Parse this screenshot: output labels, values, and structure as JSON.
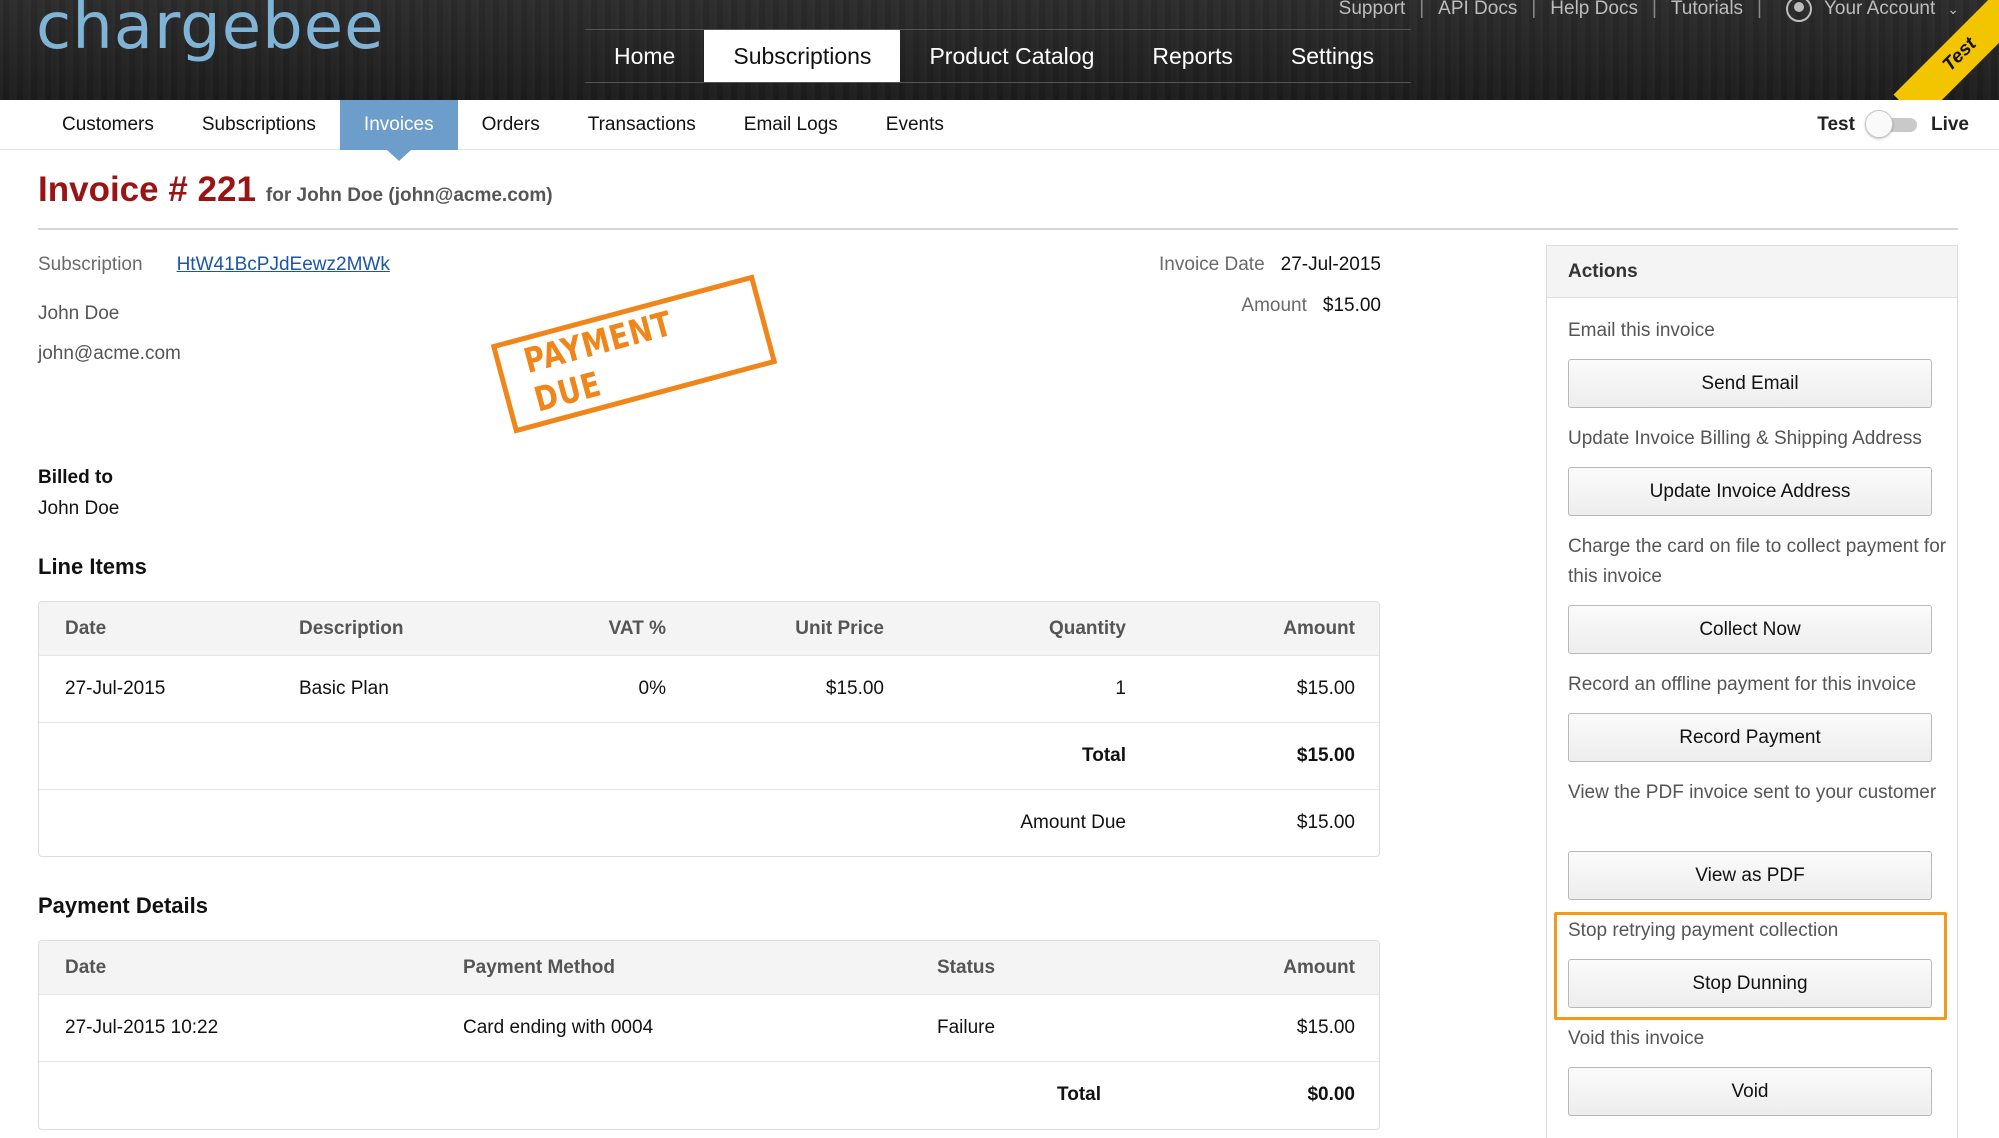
{
  "header": {
    "logo_text": "chargebee",
    "utility_links": [
      "Support",
      "API Docs",
      "Help Docs",
      "Tutorials"
    ],
    "account_label": "Your Account",
    "main_nav": [
      "Home",
      "Subscriptions",
      "Product Catalog",
      "Reports",
      "Settings"
    ],
    "main_nav_active": "Subscriptions",
    "ribbon_text": "Test",
    "ribbon_color": "#f2c500"
  },
  "subnav": {
    "items": [
      "Customers",
      "Subscriptions",
      "Invoices",
      "Orders",
      "Transactions",
      "Email Logs",
      "Events"
    ],
    "active": "Invoices",
    "active_color": "#6d9ecb",
    "mode_left": "Test",
    "mode_right": "Live"
  },
  "invoice": {
    "title": "Invoice # 221",
    "for_text": "for John Doe (john@acme.com)",
    "subscription_label": "Subscription",
    "subscription_id": "HtW41BcPJdEewz2MWk",
    "customer_name": "John Doe",
    "customer_email": "john@acme.com",
    "stamp_text": "PAYMENT DUE",
    "invoice_date_label": "Invoice Date",
    "invoice_date": "27-Jul-2015",
    "amount_label": "Amount",
    "amount": "$15.00",
    "billed_to_label": "Billed to",
    "billed_to_name": "John Doe"
  },
  "line_items": {
    "heading": "Line Items",
    "columns": [
      "Date",
      "Description",
      "VAT %",
      "Unit Price",
      "Quantity",
      "Amount"
    ],
    "rows": [
      [
        "27-Jul-2015",
        "Basic Plan",
        "0%",
        "$15.00",
        "1",
        "$15.00"
      ]
    ],
    "total_label": "Total",
    "total_value": "$15.00",
    "amount_due_label": "Amount Due",
    "amount_due_value": "$15.00"
  },
  "payment_details": {
    "heading": "Payment Details",
    "columns": [
      "Date",
      "Payment Method",
      "Status",
      "Amount"
    ],
    "rows": [
      [
        "27-Jul-2015 10:22",
        "Card ending with 0004",
        "Failure",
        "$15.00"
      ]
    ],
    "total_label": "Total",
    "total_value": "$0.00",
    "failure_color": "#cc3a0c"
  },
  "actions": {
    "heading": "Actions",
    "items": [
      {
        "desc": "Email this invoice",
        "button": "Send Email"
      },
      {
        "desc": "Update Invoice Billing & Shipping Address",
        "button": "Update Invoice Address"
      },
      {
        "desc": "Charge the card on file to collect payment for this invoice",
        "button": "Collect Now"
      },
      {
        "desc": "Record an offline payment for this invoice",
        "button": "Record Payment"
      },
      {
        "desc": "View the PDF invoice sent to your customer",
        "button": "View as PDF"
      },
      {
        "desc": "Stop retrying payment collection",
        "button": "Stop Dunning"
      },
      {
        "desc": "Void this invoice",
        "button": "Void"
      }
    ],
    "highlight_color": "#f29a1a"
  }
}
